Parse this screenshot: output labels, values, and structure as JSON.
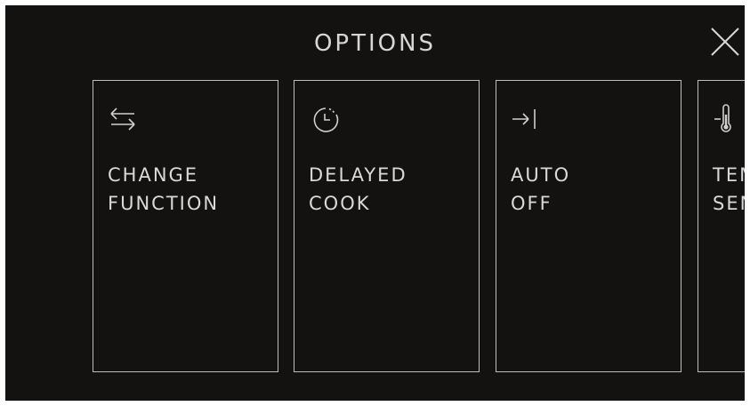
{
  "header": {
    "title": "OPTIONS"
  },
  "options": [
    {
      "line1": "CHANGE",
      "line2": "FUNCTION",
      "icon": "swap-arrows-icon"
    },
    {
      "line1": "DELAYED",
      "line2": "COOK",
      "icon": "timer-clock-icon"
    },
    {
      "line1": "AUTO",
      "line2": "OFF",
      "icon": "arrow-to-stop-icon"
    },
    {
      "line1": "TEM",
      "line2": "SEN",
      "icon": "thermometer-icon"
    }
  ],
  "colors": {
    "background": "#131211",
    "text": "#d9d9d9",
    "border": "#bdbdbd"
  }
}
